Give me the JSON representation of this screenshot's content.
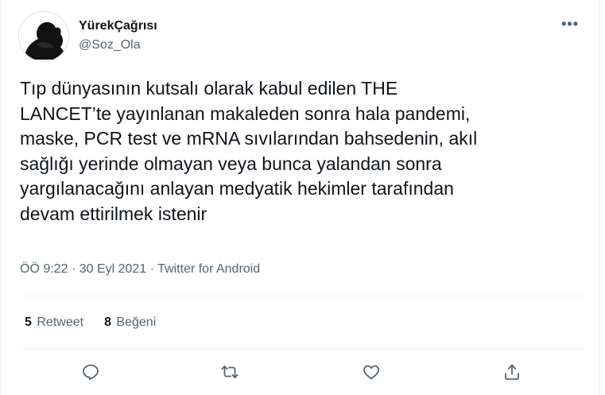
{
  "author": {
    "display_name": "YürekÇağrısı",
    "handle": "@Soz_Ola",
    "avatar_icon": "silhouette-avatar"
  },
  "tweet": {
    "text": "Tıp dünyasının kutsalı olarak kabul edilen THE\nLANCET’te yayınlanan makaleden sonra hala pandemi,\nmaske, PCR test ve mRNA sıvılarından bahsedenin, akıl\nsağlığı yerinde olmayan veya bunca yalandan sonra\nyargılanacağını anlayan medyatik hekimler tarafından\ndevam ettirilmek istenir",
    "time": "ÖÖ 9:22",
    "separator": "·",
    "date": "30 Eyl 2021",
    "source": "Twitter for Android"
  },
  "stats": {
    "retweets_count": "5",
    "retweets_label": "Retweet",
    "likes_count": "8",
    "likes_label": "Beğeni"
  },
  "actions": [
    "reply-icon",
    "retweet-icon",
    "like-icon",
    "share-icon"
  ],
  "colors": {
    "text_primary": "#0f1419",
    "text_secondary": "#536471",
    "divider": "#eff3f4"
  }
}
